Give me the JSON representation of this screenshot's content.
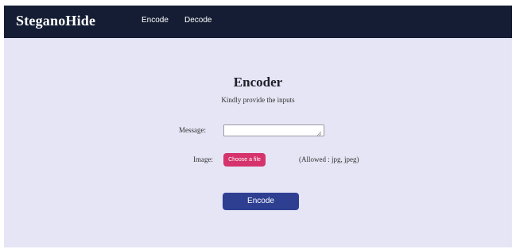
{
  "navbar": {
    "brand": "SteganoHide",
    "links": [
      {
        "label": "Encode"
      },
      {
        "label": "Decode"
      }
    ]
  },
  "form": {
    "title": "Encoder",
    "subtitle": "Kindly provide the inputs",
    "message_label": "Message:",
    "message_value": "",
    "image_label": "Image:",
    "file_button_label": "Choose a file",
    "allowed_note": "(Allowed : jpg, jpeg)",
    "submit_label": "Encode"
  },
  "colors": {
    "navbar_bg": "#141d33",
    "page_bg": "#e5e5f5",
    "file_button": "#d6336c",
    "submit_button": "#2e3f92"
  },
  "icons": {
    "resize_grip": "resize-grip-icon"
  }
}
